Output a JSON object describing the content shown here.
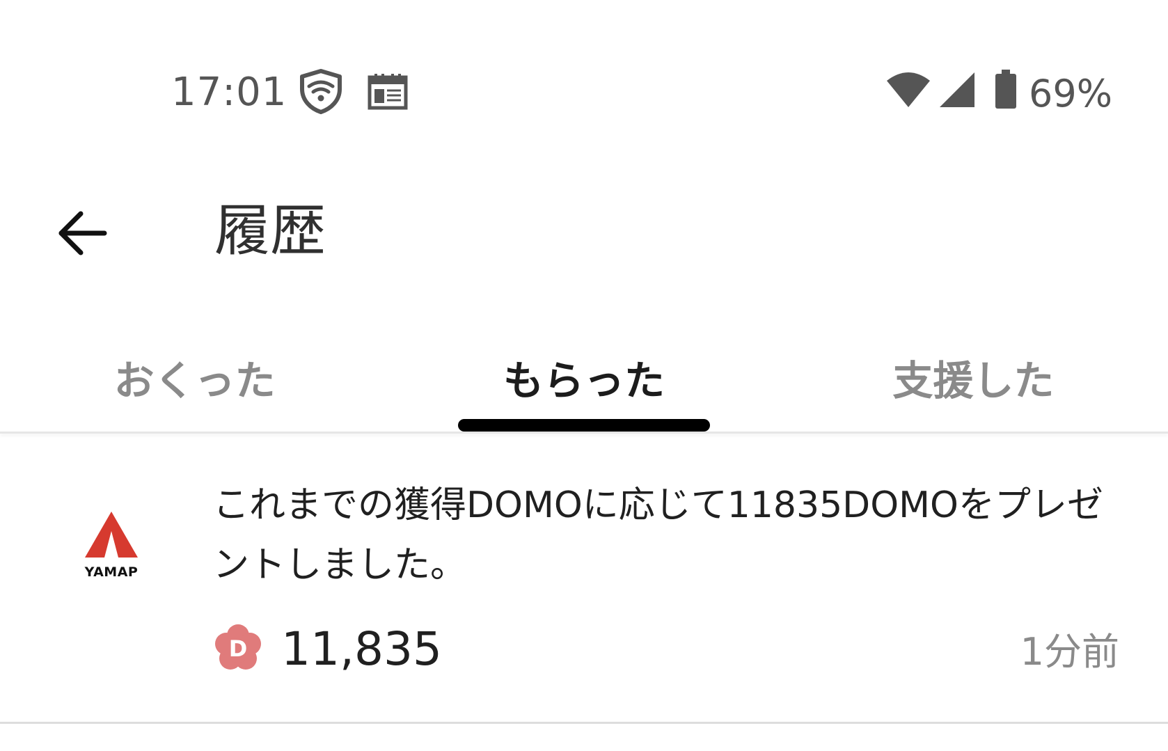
{
  "status_bar": {
    "time": "17:01",
    "battery_percent": "69%",
    "icons": [
      "shield-wifi-icon",
      "calendar-icon",
      "wifi-icon",
      "cell-signal-icon",
      "battery-icon"
    ]
  },
  "app_bar": {
    "back_icon": "arrow-left-icon",
    "title": "履歴"
  },
  "tabs": [
    {
      "label": "おくった",
      "active": false
    },
    {
      "label": "もらった",
      "active": true
    },
    {
      "label": "支援した",
      "active": false
    }
  ],
  "history_items": [
    {
      "logo_text": "YAMAP",
      "message": "これまでの獲得DOMOに応じて11835DOMOをプレゼントしました。",
      "amount": "11,835",
      "time_ago": "1分前",
      "icon": "domo-badge-icon"
    }
  ],
  "colors": {
    "brand_red": "#d63a2f",
    "domo_pink": "#e07b7b",
    "active_tab_text": "#1c1c1c",
    "inactive_tab_text": "#8a8a8a"
  }
}
